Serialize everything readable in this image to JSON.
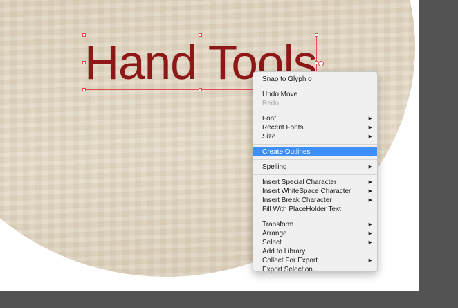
{
  "artwork": {
    "text": "Hand Tools",
    "text_color": "#8e1717",
    "background": "wood-texture-circle"
  },
  "context_menu": {
    "groups": [
      [
        {
          "label": "Snap to Glyph ",
          "suffix": "o",
          "state": "enabled"
        }
      ],
      [
        {
          "label": "Undo Move",
          "state": "enabled"
        },
        {
          "label": "Redo",
          "state": "disabled"
        }
      ],
      [
        {
          "label": "Font",
          "submenu": true,
          "state": "enabled"
        },
        {
          "label": "Recent Fonts",
          "submenu": true,
          "state": "enabled"
        },
        {
          "label": "Size",
          "submenu": true,
          "state": "enabled"
        }
      ],
      [
        {
          "label": "Create Outlines",
          "state": "highlighted"
        }
      ],
      [
        {
          "label": "Spelling",
          "submenu": true,
          "state": "enabled"
        }
      ],
      [
        {
          "label": "Insert Special Character",
          "submenu": true,
          "state": "enabled"
        },
        {
          "label": "Insert WhiteSpace Character",
          "submenu": true,
          "state": "enabled"
        },
        {
          "label": "Insert Break Character",
          "submenu": true,
          "state": "enabled"
        },
        {
          "label": "Fill With PlaceHolder Text",
          "state": "enabled"
        }
      ],
      [
        {
          "label": "Transform",
          "submenu": true,
          "state": "enabled"
        },
        {
          "label": "Arrange",
          "submenu": true,
          "state": "enabled"
        },
        {
          "label": "Select",
          "submenu": true,
          "state": "enabled"
        },
        {
          "label": "Add to Library",
          "state": "enabled"
        },
        {
          "label": "Collect For Export",
          "submenu": true,
          "state": "enabled"
        },
        {
          "label": "Export Selection...",
          "state": "enabled"
        }
      ]
    ],
    "submenu_arrow_icon": "triangle-right-icon",
    "highlight_color": "#3e8ef7"
  },
  "colors": {
    "pasteboard": "#535353",
    "selection": "#e8494f"
  }
}
